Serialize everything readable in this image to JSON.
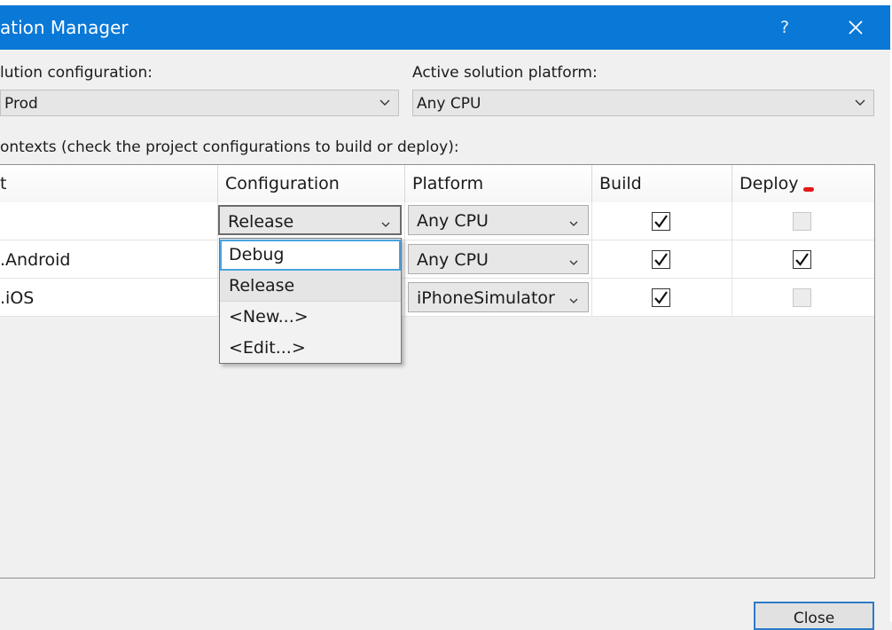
{
  "window": {
    "title": "ation Manager",
    "help": "?",
    "close_icon": "close-icon"
  },
  "solution_config": {
    "label": "lution configuration:",
    "value": "Prod"
  },
  "solution_platform": {
    "label": "Active solution platform:",
    "value": "Any CPU"
  },
  "contexts_label": "ontexts (check the project configurations to build or deploy):",
  "grid": {
    "headers": {
      "project": "t",
      "configuration": "Configuration",
      "platform": "Platform",
      "build": "Build",
      "deploy": "Deploy"
    },
    "rows": [
      {
        "project": "",
        "configuration": "Release",
        "platform": "Any CPU",
        "build": true,
        "deploy": false,
        "deploy_enabled": false
      },
      {
        "project": ".Android",
        "configuration": "",
        "platform": "Any CPU",
        "build": true,
        "deploy": true,
        "deploy_enabled": true
      },
      {
        "project": ".iOS",
        "configuration": "",
        "platform": "iPhoneSimulator",
        "build": true,
        "deploy": false,
        "deploy_enabled": false
      }
    ]
  },
  "dropdown": {
    "options": [
      "Debug",
      "Release",
      "<New...>",
      "<Edit...>"
    ],
    "focused": "Debug",
    "hover": "Release"
  },
  "footer": {
    "close_label": "Close"
  },
  "colors": {
    "titlebar": "#0a78d7",
    "focus": "#4aa3df",
    "annotation": "#e2181b"
  }
}
